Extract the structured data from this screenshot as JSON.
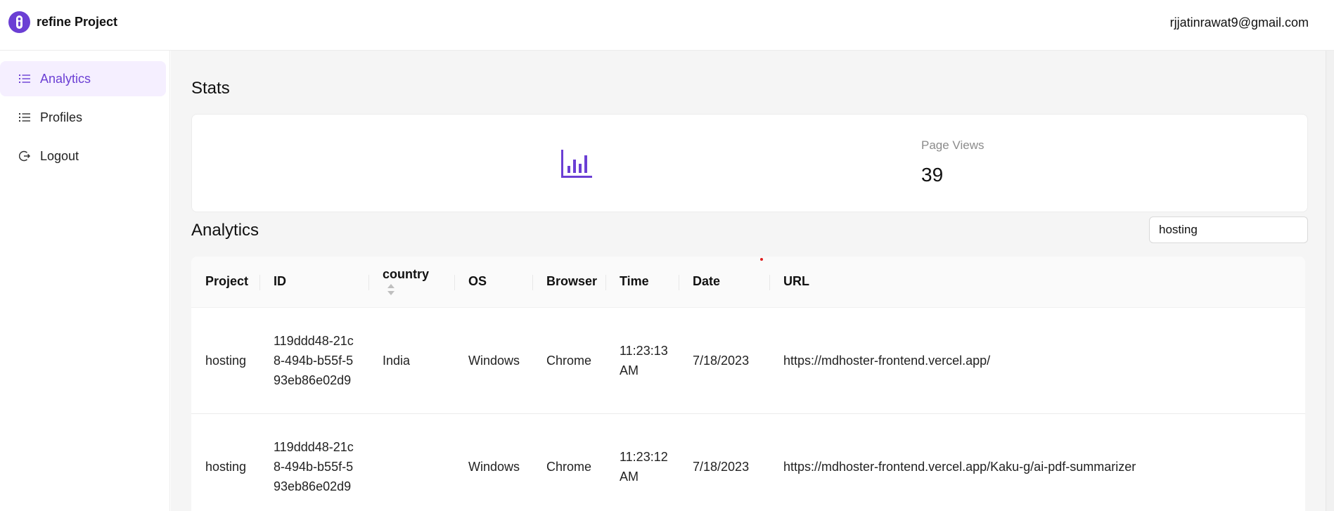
{
  "header": {
    "brand_name": "refine Project",
    "user_email": "rjjatinrawat9@gmail.com"
  },
  "sidebar": {
    "items": [
      {
        "label": "Analytics",
        "icon": "list-icon",
        "active": true
      },
      {
        "label": "Profiles",
        "icon": "list-icon",
        "active": false
      },
      {
        "label": "Logout",
        "icon": "logout-icon",
        "active": false
      }
    ]
  },
  "stats": {
    "title": "Stats",
    "card": {
      "icon": "bar-chart-icon",
      "label": "Page Views",
      "value": "39"
    }
  },
  "analytics": {
    "title": "Analytics",
    "search": {
      "value": "hosting",
      "placeholder": ""
    },
    "columns": [
      "Project",
      "ID",
      "country",
      "OS",
      "Browser",
      "Time",
      "Date",
      "URL"
    ],
    "rows": [
      {
        "project": "hosting",
        "id": "119ddd48-21c8-494b-b55f-593eb86e02d9",
        "country": "India",
        "os": "Windows",
        "browser": "Chrome",
        "time": "11:23:13 AM",
        "date": "7/18/2023",
        "url": "https://mdhoster-frontend.vercel.app/"
      },
      {
        "project": "hosting",
        "id": "119ddd48-21c8-494b-b55f-593eb86e02d9",
        "country": "",
        "os": "Windows",
        "browser": "Chrome",
        "time": "11:23:12 AM",
        "date": "7/18/2023",
        "url": "https://mdhoster-frontend.vercel.app/Kaku-g/ai-pdf-summarizer"
      }
    ]
  },
  "colors": {
    "accent": "#6b3fd4",
    "active_bg": "#f5efff",
    "content_bg": "#f5f5f5"
  }
}
